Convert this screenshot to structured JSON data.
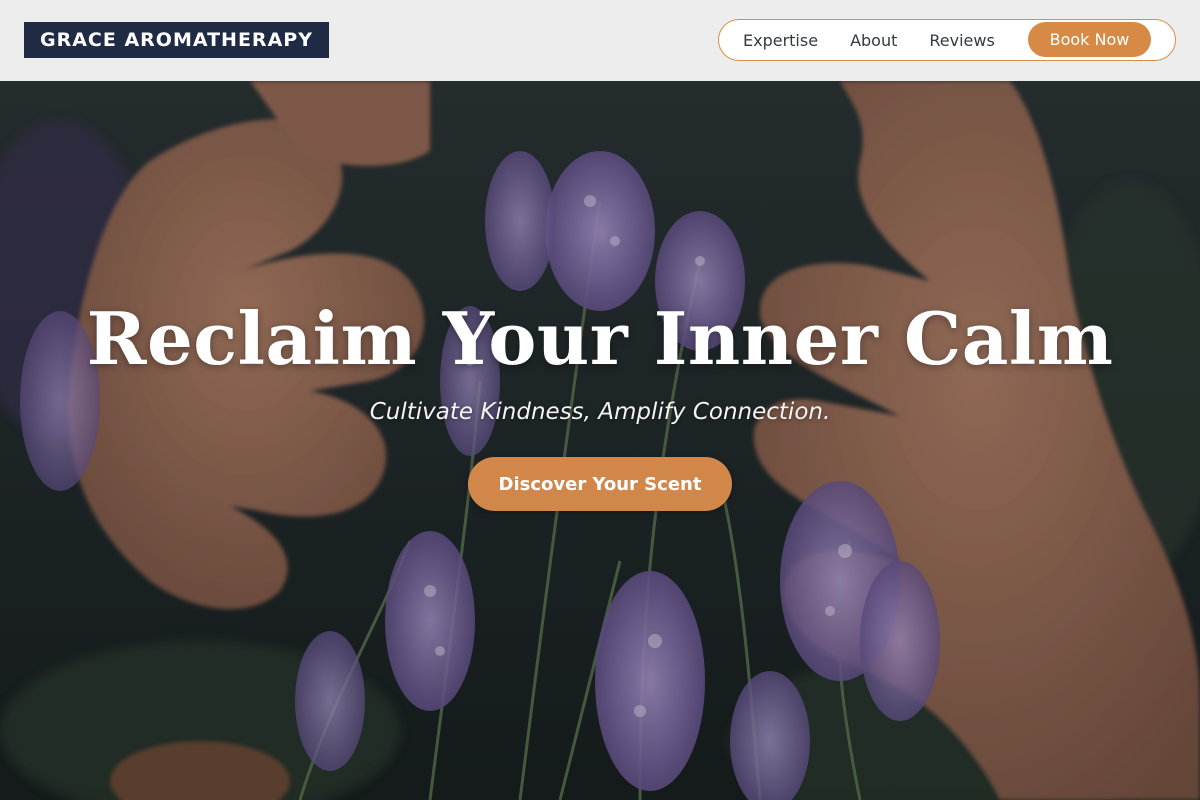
{
  "header": {
    "logo_text": "GRACE AROMATHERAPY",
    "nav": [
      {
        "label": "Expertise"
      },
      {
        "label": "About"
      },
      {
        "label": "Reviews"
      }
    ],
    "cta_label": "Book Now"
  },
  "hero": {
    "title": "Reclaim Your Inner Calm",
    "subtitle": "Cultivate Kindness, Amplify Connection.",
    "cta_label": "Discover Your Scent",
    "background": "photo-hands-in-lavender-field"
  },
  "colors": {
    "brand_navy": "#1f2a44",
    "accent_orange": "#d68a46",
    "header_bg": "#f4f4f4",
    "lavender": "#9a83c6"
  }
}
